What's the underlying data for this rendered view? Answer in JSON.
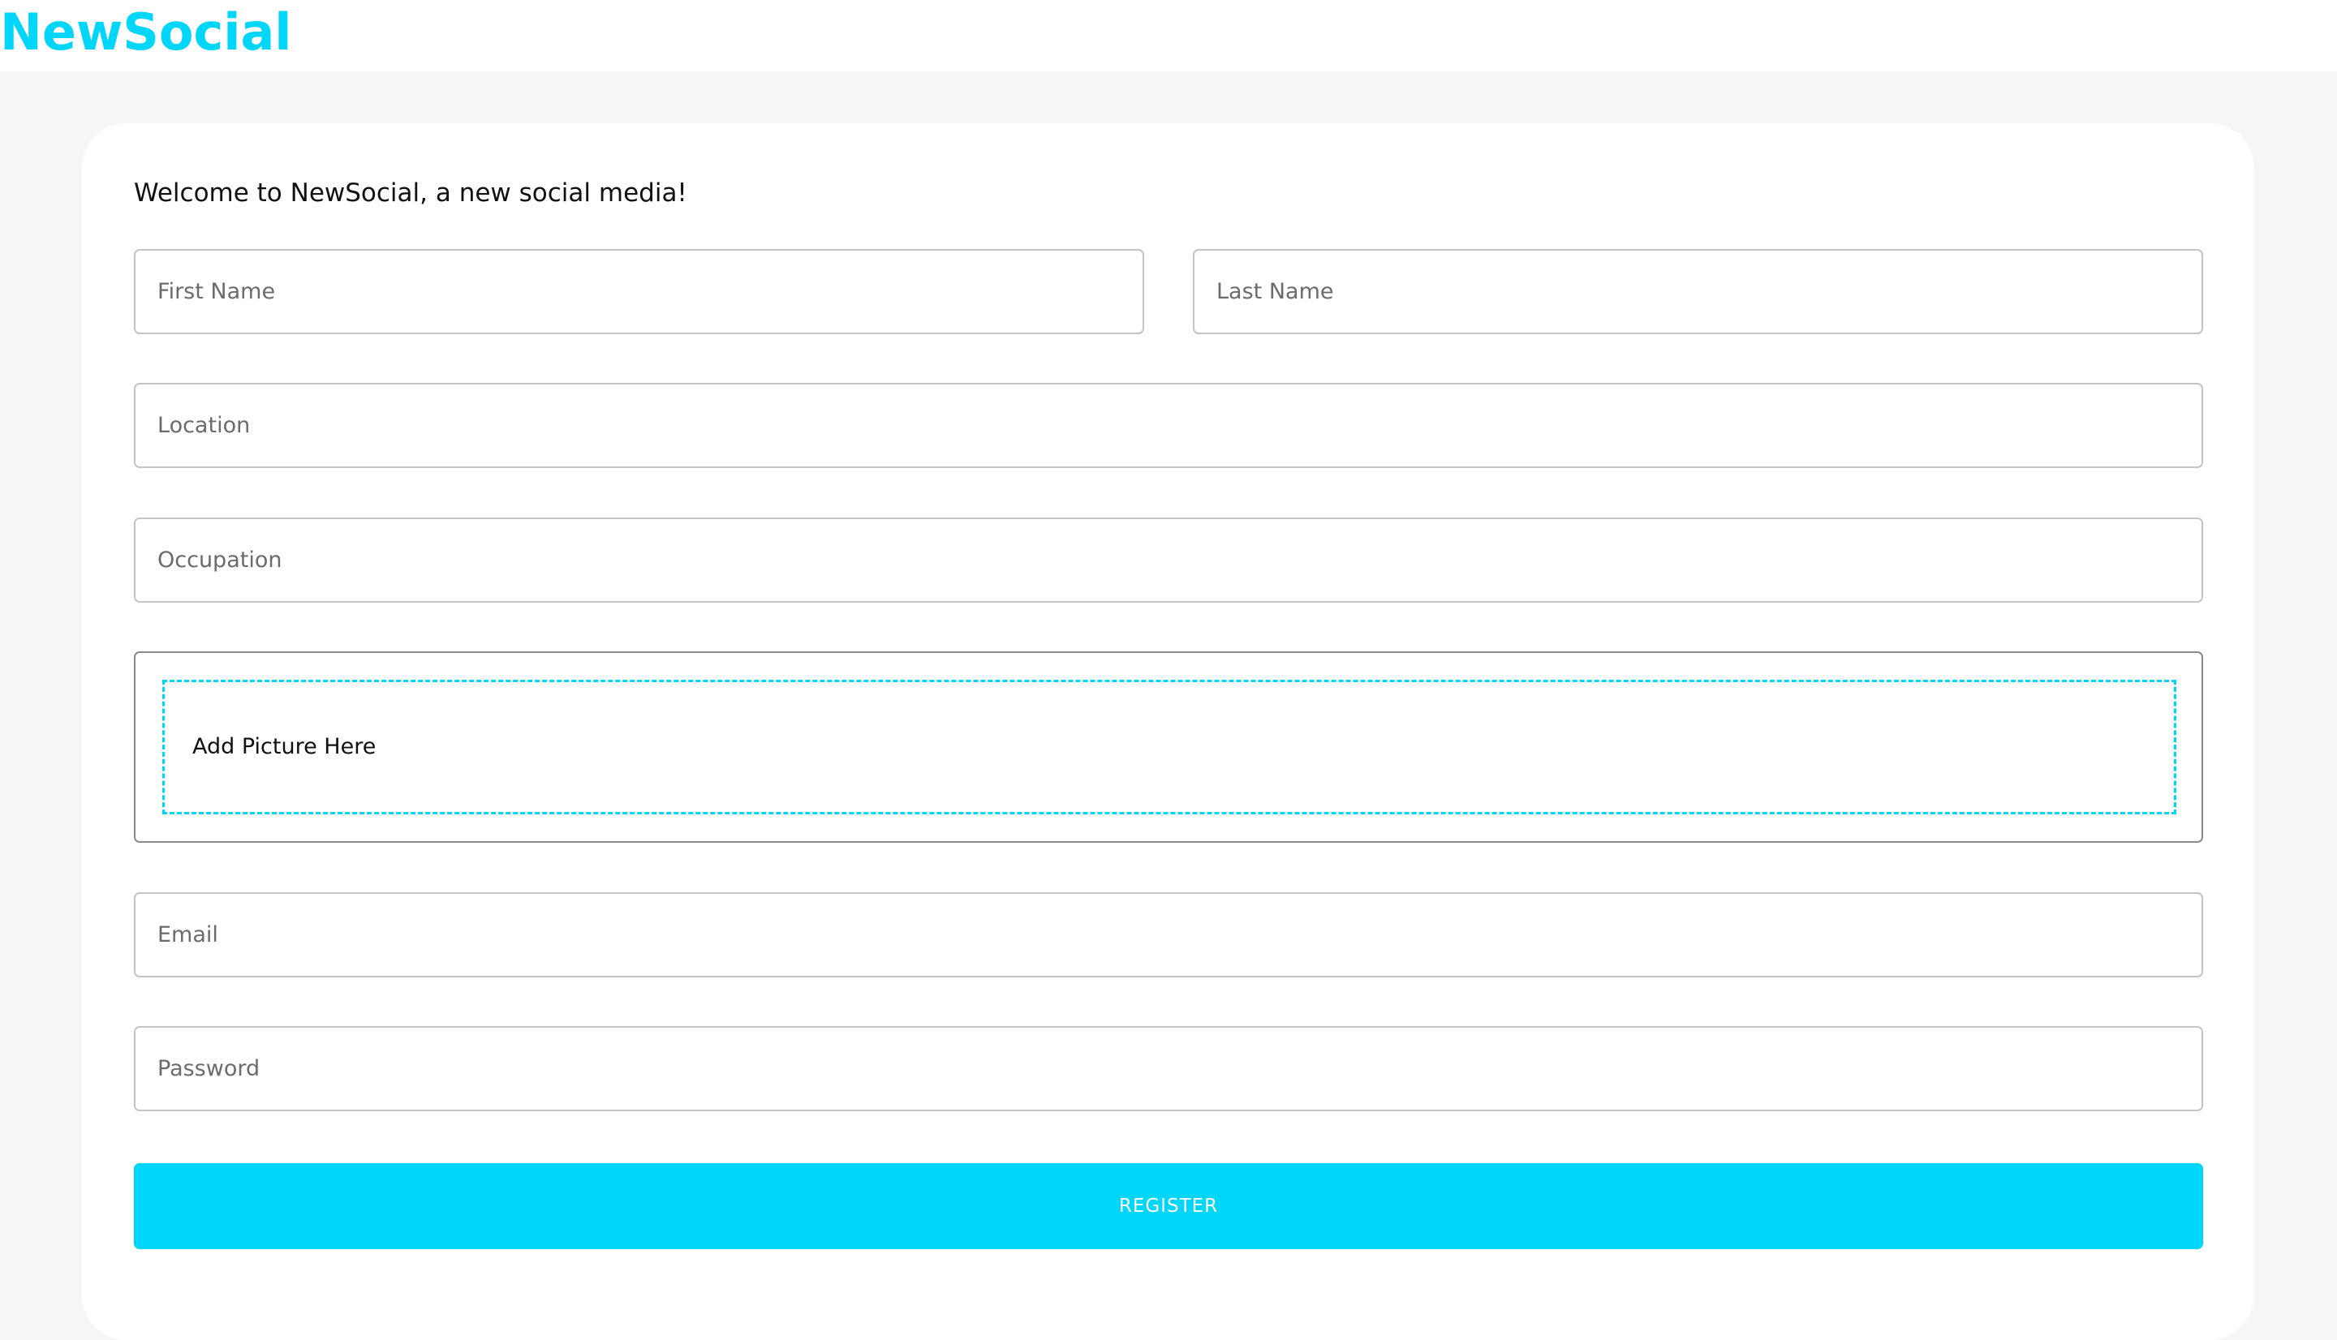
{
  "brand": {
    "name": "NewSocial",
    "color": "#00d5fa"
  },
  "form": {
    "welcome": "Welcome to NewSocial, a new social media!",
    "first_name": {
      "placeholder": "First Name",
      "value": ""
    },
    "last_name": {
      "placeholder": "Last Name",
      "value": ""
    },
    "location": {
      "placeholder": "Location",
      "value": ""
    },
    "occupation": {
      "placeholder": "Occupation",
      "value": ""
    },
    "picture": {
      "label": "Add Picture Here"
    },
    "email": {
      "placeholder": "Email",
      "value": ""
    },
    "password": {
      "placeholder": "Password",
      "value": ""
    },
    "register_label": "REGISTER"
  },
  "colors": {
    "accent": "#00d5fa",
    "page_background": "#f6f6f6",
    "card_background": "#ffffff"
  }
}
